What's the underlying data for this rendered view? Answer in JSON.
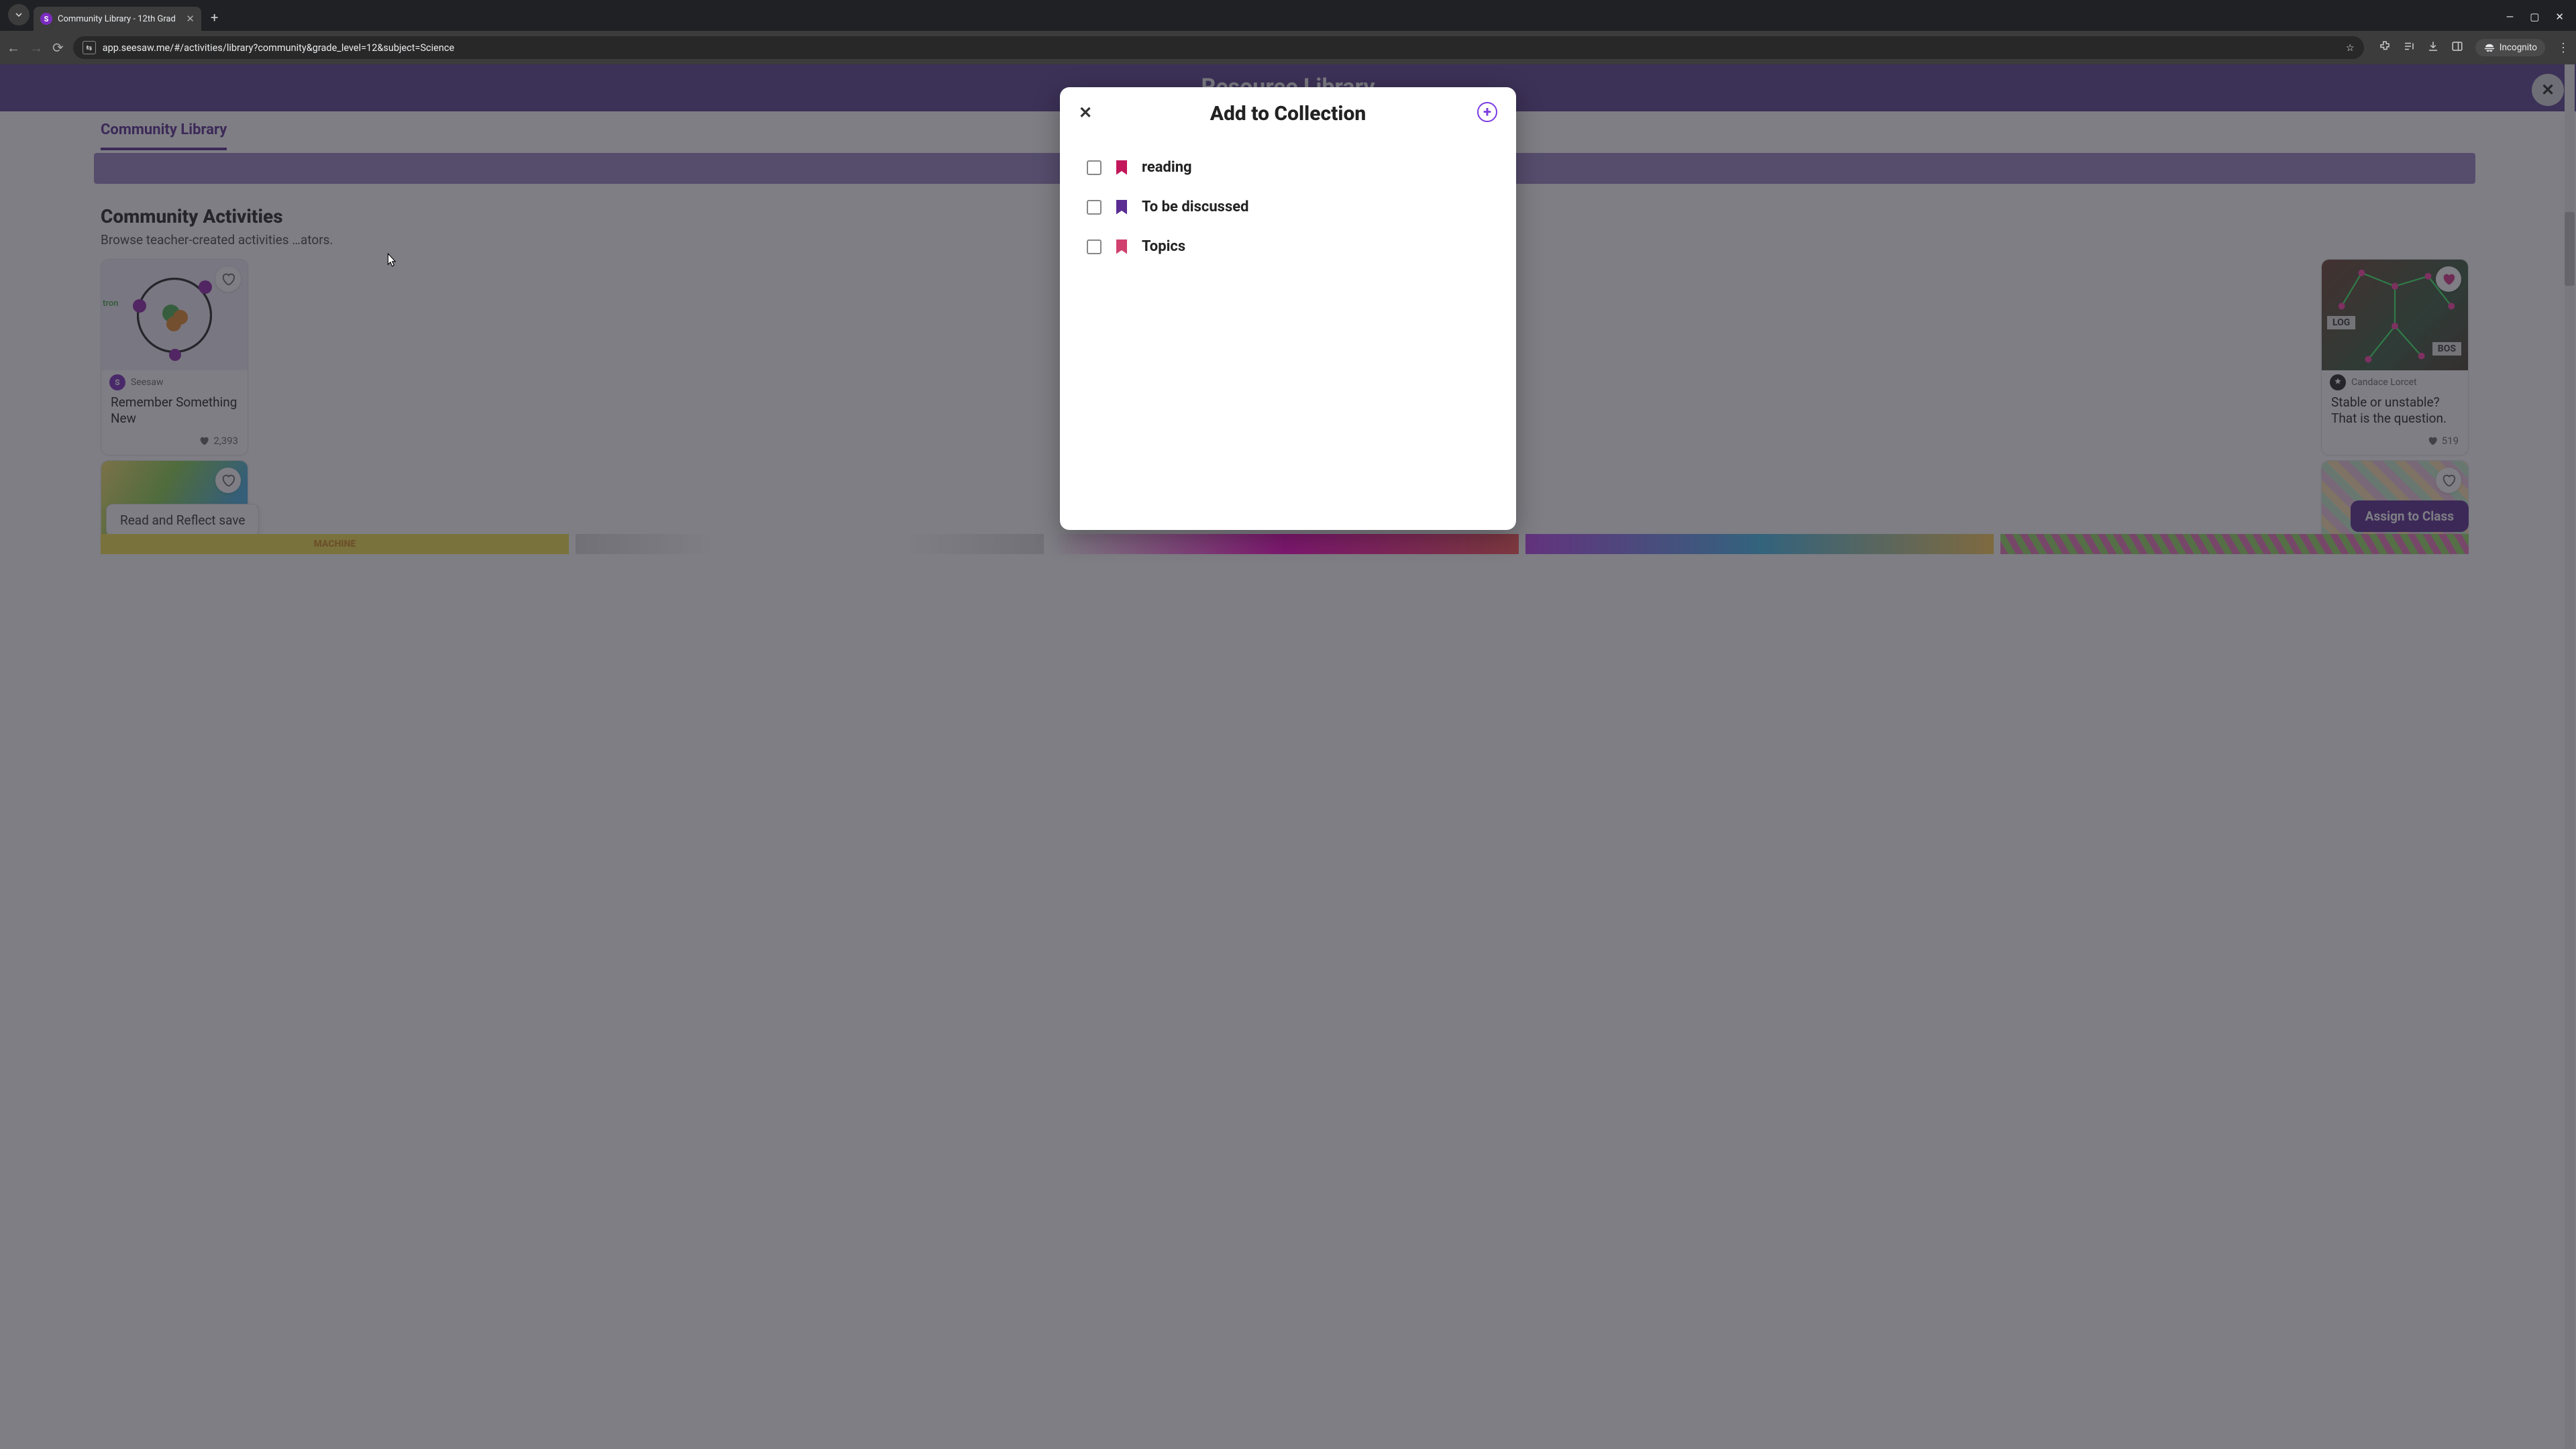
{
  "browser": {
    "tab_title": "Community Library - 12th Grad",
    "url": "app.seesaw.me/#/activities/library?community&grade_level=12&subject=Science",
    "incognito_label": "Incognito"
  },
  "page_header": {
    "title": "Resource Library",
    "active_tab": "Community Library"
  },
  "section": {
    "title": "Community Activities",
    "subtitle": "Browse teacher-created activities …ators."
  },
  "cards": [
    {
      "author": "Seesaw",
      "title": "Remember Something New",
      "likes": "2,393",
      "hearted": false
    },
    {
      "author": "Candace Lorcet",
      "title": "Stable or unstable? That is the question.",
      "likes": "519",
      "hearted": true,
      "labels": [
        "LOG",
        "BOS"
      ]
    }
  ],
  "toast": "Read and Reflect save",
  "assign_button": "Assign to Class",
  "modal": {
    "title": "Add to Collection",
    "items": [
      {
        "name": "reading",
        "color": "#c2185b"
      },
      {
        "name": "To be discussed",
        "color": "#5b2c92"
      },
      {
        "name": "Topics",
        "color": "#d1416f"
      }
    ]
  }
}
